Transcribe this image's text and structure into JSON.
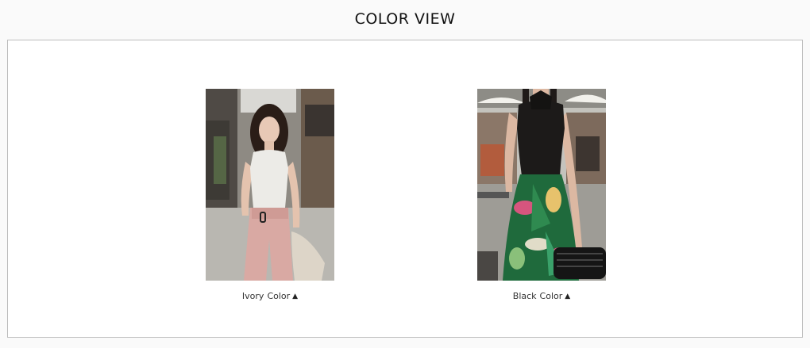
{
  "header": {
    "title": "COLOR VIEW"
  },
  "colors": [
    {
      "name": "Ivory",
      "suffix": "Color",
      "arrow": "▲",
      "icon": "triangle-up-icon"
    },
    {
      "name": "Black",
      "suffix": "Color",
      "arrow": "▲",
      "icon": "triangle-up-icon"
    }
  ],
  "palette": {
    "background": "#fafafa",
    "panel_border": "#bdbdbd",
    "text": "#333333"
  }
}
